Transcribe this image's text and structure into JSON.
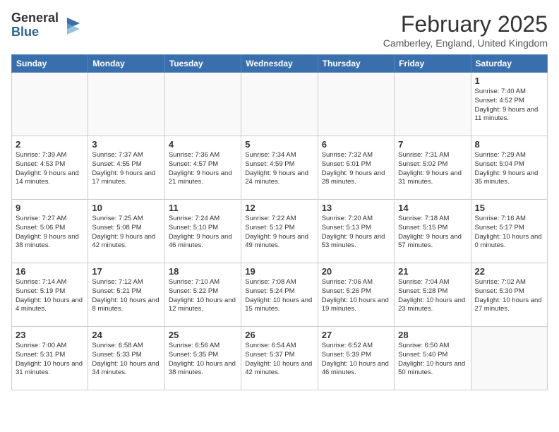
{
  "header": {
    "logo_general": "General",
    "logo_blue": "Blue",
    "month_year": "February 2025",
    "location": "Camberley, England, United Kingdom"
  },
  "days_of_week": [
    "Sunday",
    "Monday",
    "Tuesday",
    "Wednesday",
    "Thursday",
    "Friday",
    "Saturday"
  ],
  "weeks": [
    [
      {
        "day": "",
        "info": ""
      },
      {
        "day": "",
        "info": ""
      },
      {
        "day": "",
        "info": ""
      },
      {
        "day": "",
        "info": ""
      },
      {
        "day": "",
        "info": ""
      },
      {
        "day": "",
        "info": ""
      },
      {
        "day": "1",
        "info": "Sunrise: 7:40 AM\nSunset: 4:52 PM\nDaylight: 9 hours and 11 minutes."
      }
    ],
    [
      {
        "day": "2",
        "info": "Sunrise: 7:39 AM\nSunset: 4:53 PM\nDaylight: 9 hours and 14 minutes."
      },
      {
        "day": "3",
        "info": "Sunrise: 7:37 AM\nSunset: 4:55 PM\nDaylight: 9 hours and 17 minutes."
      },
      {
        "day": "4",
        "info": "Sunrise: 7:36 AM\nSunset: 4:57 PM\nDaylight: 9 hours and 21 minutes."
      },
      {
        "day": "5",
        "info": "Sunrise: 7:34 AM\nSunset: 4:59 PM\nDaylight: 9 hours and 24 minutes."
      },
      {
        "day": "6",
        "info": "Sunrise: 7:32 AM\nSunset: 5:01 PM\nDaylight: 9 hours and 28 minutes."
      },
      {
        "day": "7",
        "info": "Sunrise: 7:31 AM\nSunset: 5:02 PM\nDaylight: 9 hours and 31 minutes."
      },
      {
        "day": "8",
        "info": "Sunrise: 7:29 AM\nSunset: 5:04 PM\nDaylight: 9 hours and 35 minutes."
      }
    ],
    [
      {
        "day": "9",
        "info": "Sunrise: 7:27 AM\nSunset: 5:06 PM\nDaylight: 9 hours and 38 minutes."
      },
      {
        "day": "10",
        "info": "Sunrise: 7:25 AM\nSunset: 5:08 PM\nDaylight: 9 hours and 42 minutes."
      },
      {
        "day": "11",
        "info": "Sunrise: 7:24 AM\nSunset: 5:10 PM\nDaylight: 9 hours and 46 minutes."
      },
      {
        "day": "12",
        "info": "Sunrise: 7:22 AM\nSunset: 5:12 PM\nDaylight: 9 hours and 49 minutes."
      },
      {
        "day": "13",
        "info": "Sunrise: 7:20 AM\nSunset: 5:13 PM\nDaylight: 9 hours and 53 minutes."
      },
      {
        "day": "14",
        "info": "Sunrise: 7:18 AM\nSunset: 5:15 PM\nDaylight: 9 hours and 57 minutes."
      },
      {
        "day": "15",
        "info": "Sunrise: 7:16 AM\nSunset: 5:17 PM\nDaylight: 10 hours and 0 minutes."
      }
    ],
    [
      {
        "day": "16",
        "info": "Sunrise: 7:14 AM\nSunset: 5:19 PM\nDaylight: 10 hours and 4 minutes."
      },
      {
        "day": "17",
        "info": "Sunrise: 7:12 AM\nSunset: 5:21 PM\nDaylight: 10 hours and 8 minutes."
      },
      {
        "day": "18",
        "info": "Sunrise: 7:10 AM\nSunset: 5:22 PM\nDaylight: 10 hours and 12 minutes."
      },
      {
        "day": "19",
        "info": "Sunrise: 7:08 AM\nSunset: 5:24 PM\nDaylight: 10 hours and 15 minutes."
      },
      {
        "day": "20",
        "info": "Sunrise: 7:06 AM\nSunset: 5:26 PM\nDaylight: 10 hours and 19 minutes."
      },
      {
        "day": "21",
        "info": "Sunrise: 7:04 AM\nSunset: 5:28 PM\nDaylight: 10 hours and 23 minutes."
      },
      {
        "day": "22",
        "info": "Sunrise: 7:02 AM\nSunset: 5:30 PM\nDaylight: 10 hours and 27 minutes."
      }
    ],
    [
      {
        "day": "23",
        "info": "Sunrise: 7:00 AM\nSunset: 5:31 PM\nDaylight: 10 hours and 31 minutes."
      },
      {
        "day": "24",
        "info": "Sunrise: 6:58 AM\nSunset: 5:33 PM\nDaylight: 10 hours and 34 minutes."
      },
      {
        "day": "25",
        "info": "Sunrise: 6:56 AM\nSunset: 5:35 PM\nDaylight: 10 hours and 38 minutes."
      },
      {
        "day": "26",
        "info": "Sunrise: 6:54 AM\nSunset: 5:37 PM\nDaylight: 10 hours and 42 minutes."
      },
      {
        "day": "27",
        "info": "Sunrise: 6:52 AM\nSunset: 5:39 PM\nDaylight: 10 hours and 46 minutes."
      },
      {
        "day": "28",
        "info": "Sunrise: 6:50 AM\nSunset: 5:40 PM\nDaylight: 10 hours and 50 minutes."
      },
      {
        "day": "",
        "info": ""
      }
    ]
  ]
}
